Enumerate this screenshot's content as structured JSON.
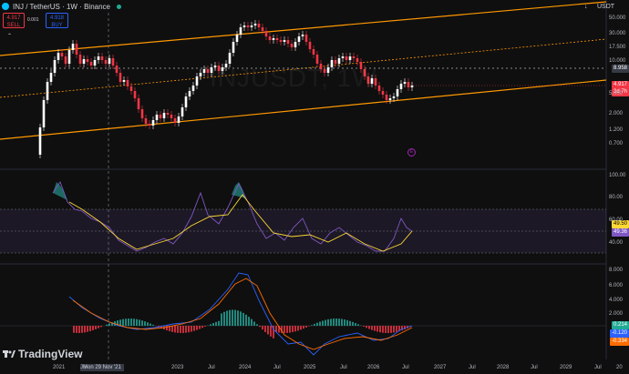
{
  "symbol": {
    "title": "INJ / TetherUS · 1W · Binance",
    "watermark": "INJUSDT, 1W"
  },
  "trade": {
    "sell_price": "4.917",
    "sell_label": "SELL",
    "spread": "0.001",
    "buy_price": "4.918",
    "buy_label": "BUY"
  },
  "toolbar": {
    "currency": "USDT",
    "collapse_icon": "chevron-up-icon",
    "arrow_icon": "arrow-down-icon",
    "settings_icon": "gear-icon"
  },
  "price_axis": {
    "ticks": [
      "50.000",
      "30.000",
      "17.500",
      "10.000",
      "5.000",
      "2.000",
      "1.200",
      "0.700"
    ],
    "current_price": "4.917",
    "countdown": "3d 7h",
    "line_price": "8.958"
  },
  "rsi_axis": {
    "ticks": [
      "100.00",
      "80.00",
      "60.00",
      "40.00"
    ],
    "rsi_value": "49.36",
    "rsi_ma_value": "49.50",
    "upper_band": "70.00"
  },
  "macd_axis": {
    "ticks": [
      "8.000",
      "6.000",
      "4.000",
      "2.000"
    ],
    "hist_value": "0.214",
    "macd_value": "-0.120",
    "signal_value": "-0.334"
  },
  "time_axis": {
    "labels": [
      "2021",
      "Jul",
      "2023",
      "Jul",
      "2024",
      "Jul",
      "2025",
      "Jul",
      "2026",
      "Jul",
      "2027",
      "Jul",
      "2028",
      "Jul",
      "2029",
      "Jul",
      "20"
    ],
    "cursor_date": "Mon 29 Nov '21"
  },
  "brand": {
    "logo_text": "TradingView"
  },
  "colors": {
    "up": "#ffffff",
    "down": "#f23645",
    "channel": "#ff9800",
    "rsi": "#7e57c2",
    "rsi_ma": "#fdd835",
    "macd": "#2962ff",
    "signal": "#ff6d00",
    "price_tag": "#f23645"
  }
}
